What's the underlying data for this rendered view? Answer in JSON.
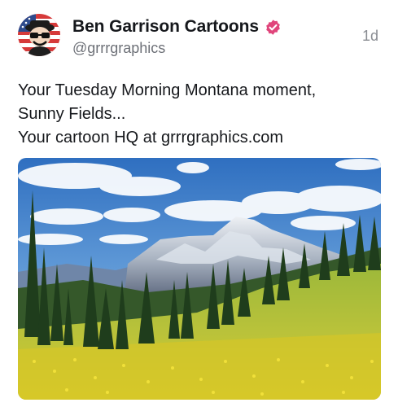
{
  "post": {
    "author": {
      "display_name": "Ben Garrison Cartoons",
      "handle": "@grrrgraphics",
      "verified": true,
      "avatar_icon": "cartoon-avatar-flag-icon"
    },
    "timestamp": "1d",
    "text_lines": [
      "Your Tuesday Morning Montana moment,",
      "Sunny Fields...",
      "Your cartoon HQ at grrrgraphics.com"
    ],
    "media": {
      "type": "photo",
      "subject": "mountain meadow with yellow wildflowers, evergreen trees and snow-capped peak"
    },
    "colors": {
      "verified_badge": "#e0457b",
      "text_primary": "#16181c",
      "text_secondary": "#6d7077"
    }
  }
}
